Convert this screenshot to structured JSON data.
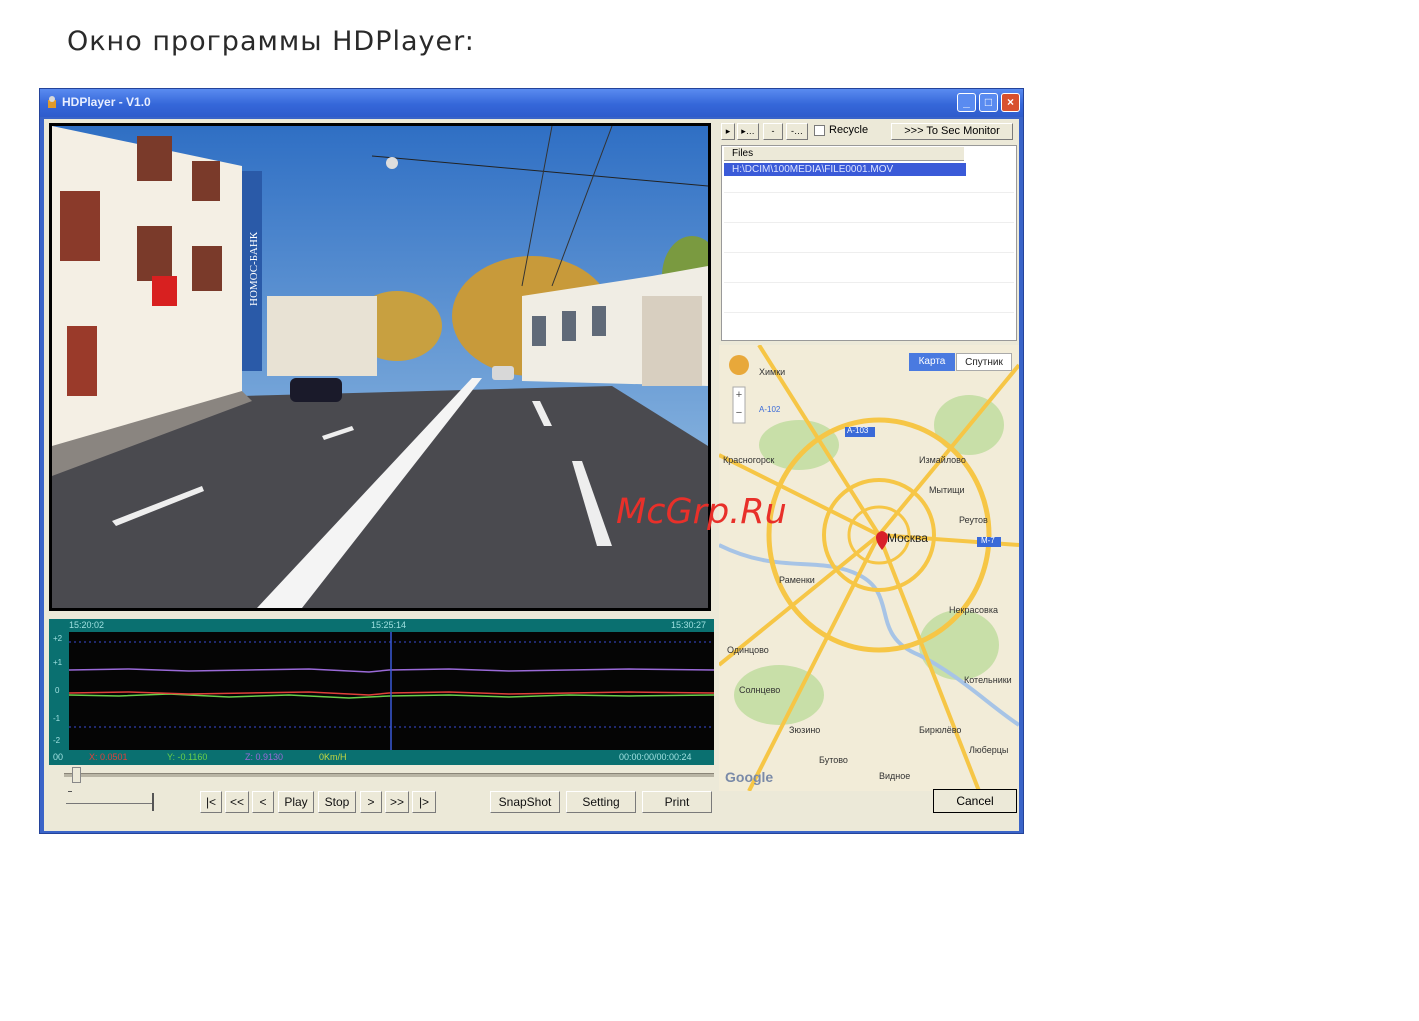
{
  "caption": "Окно программы HDPlayer:",
  "window": {
    "title": "HDPlayer - V1.0",
    "icon": "app-icon",
    "controls": [
      "minimize-icon",
      "maximize-icon",
      "close-icon"
    ]
  },
  "video": {
    "street_sign": "НОМОС-БАНК"
  },
  "graph": {
    "time_start": "15:20:02",
    "time_mid": "15:25:14",
    "time_end": "15:30:27",
    "y_ticks": [
      "+2",
      "+1",
      "0",
      "-1",
      "-2"
    ],
    "bottom_left": "00",
    "x_readout": "X: 0.0501",
    "y_readout": "Y: -0.1160",
    "z_readout": "Z: 0.9130",
    "speed": "0Km/H",
    "timecode": "00:00:00/00:00:24",
    "colors": {
      "bg": "#050505",
      "frame": "#0a7070",
      "x": "#e0403a",
      "y": "#6ad04a",
      "z": "#9a6ad8",
      "cursor": "#3a5ad8"
    }
  },
  "transport": {
    "first": "|<",
    "rewind": "<<",
    "prev": "<",
    "play": "Play",
    "stop": "Stop",
    "next": ">",
    "forward": ">>",
    "last": "|>",
    "snapshot": "SnapShot",
    "setting": "Setting",
    "print": "Print",
    "cancel": "Cancel"
  },
  "file_panel": {
    "recycle_label": "Recycle",
    "to_sec_monitor": ">>> To Sec Monitor",
    "files_header": "Files",
    "files": [
      "H:\\DCIM\\100MEDIA\\FILE0001.MOV"
    ]
  },
  "map": {
    "tab_map": "Карта",
    "tab_satellite": "Спутник",
    "city": "Москва",
    "labels": [
      "Химки",
      "Мытищи",
      "Реутов",
      "Люберцы",
      "Красногорск",
      "Одинцово",
      "Видное",
      "Зюзино",
      "Бутово",
      "Бирюлёво",
      "Раменки",
      "Солнцево",
      "Котельники",
      "Некрасовка",
      "Измайлово"
    ],
    "roads": [
      "A-103",
      "M-7",
      "A-102"
    ],
    "attribution": "Google",
    "colors": {
      "land": "#f2ecd8",
      "roads": "#f6c646",
      "water": "#a7c4e6",
      "parks": "#c8dfa8"
    }
  },
  "watermark": "McGrp.Ru"
}
